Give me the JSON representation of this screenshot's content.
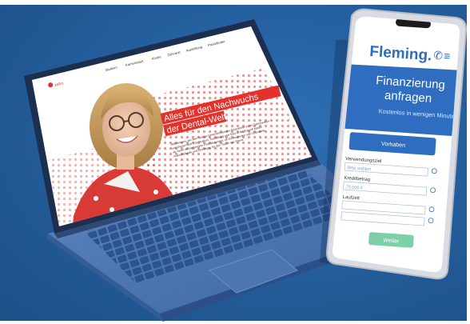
{
  "laptop": {
    "nav_items": [
      "Studium",
      "Karrierestart",
      "Kinder",
      "Zahnarzt",
      "Ausbildung",
      "Praxisfinder"
    ],
    "headline_line1": "Alles für den Nachwuchs",
    "headline_line2": "der Dental-Welt",
    "body_text_lines": [
      "Willkommen, bei dem Tochter-Unternehmen der Finanzierer in der Zahnmedizin",
      "und Dental-Welt. Für Studium, Ausbildung und Start in die Zukunft bieten",
      "wir Ihnen die passenden Finanzierungen, ob für Studenten oder Zahnärzte,",
      "Auszubildende und Einsteiger, für den Traum von Praxis."
    ]
  },
  "phone": {
    "logo": "Fleming.",
    "title_line1": "Finanzierung",
    "title_line2": "anfragen",
    "subtitle": "Kostenlos in wenigen Minuten",
    "primary_button": "Vorhaben",
    "fields": [
      {
        "label": "Verwendungsziel",
        "value": "Bitte wählen"
      },
      {
        "label": "Kreditbetrag",
        "value": "75.000 €"
      },
      {
        "label": "Laufzeit",
        "value": ""
      }
    ],
    "next_button": "Weiter"
  },
  "colors": {
    "background": "#245f9e",
    "accent_red": "#e4312b",
    "phone_blue": "#2e6dbf",
    "next_green": "#7ccfa6"
  }
}
